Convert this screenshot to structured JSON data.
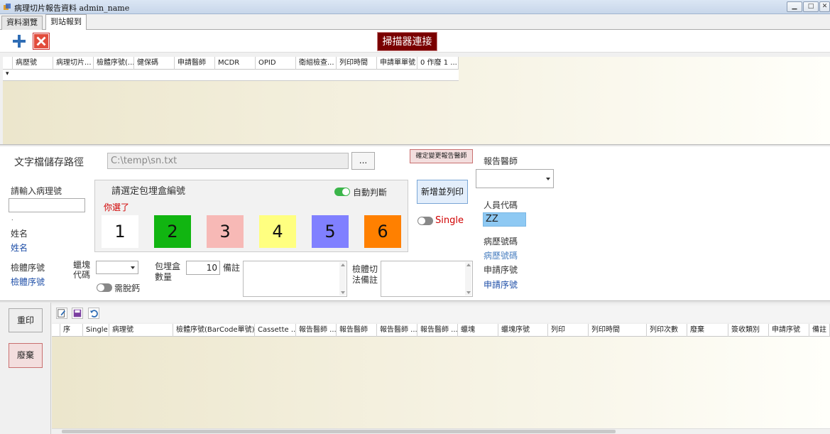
{
  "window": {
    "title": "病理切片報告資料 admin_name",
    "minimize_glyph": "▁",
    "maximize_glyph": "□",
    "close_glyph": "✕"
  },
  "tabs": [
    {
      "label": "資料瀏覽"
    },
    {
      "label": "到站報到"
    }
  ],
  "toolbar": {
    "add_icon": "plus-icon",
    "delete_icon": "close-icon",
    "scanner_label": "掃描器連接"
  },
  "top_grid": {
    "columns": [
      "病歷號",
      "病理切片...",
      "檢體序號(...",
      "健保碼",
      "申請醫師",
      "MCDR",
      "OPID",
      "衛組檢查...",
      "列印時間",
      "申請單單號",
      "0 作廢 1 ..."
    ],
    "row_marker": "▾"
  },
  "form": {
    "path_label": "文字檔儲存路徑",
    "path_value": "C:\\temp\\sn.txt",
    "browse_label": "...",
    "confirm_doctor_label": "確定變更報告醫師",
    "report_doctor_label": "報告醫師",
    "pathology_input_label": "請輸入病理號",
    "dot": ".",
    "name_label": "姓名",
    "name_value": "姓名",
    "specimen_no_label": "檢體序號",
    "specimen_no_value": "檢體序號",
    "block_code_label": "蠟塊代碼",
    "decal_label": "需脫鈣",
    "box_count_label": "包埋盒數量",
    "box_count_value": "10",
    "remark_label": "備註",
    "cutting_remark_label": "檢體切法備註",
    "new_print_label": "新增並列印",
    "single_label": "Single",
    "staff_code_label": "人員代碼",
    "staff_code_value": "ZZ",
    "chart_no_label": "病歷號碼",
    "chart_no_value": "病歷號碼",
    "application_no_label": "申請序號",
    "application_no_value": "申請序號"
  },
  "cassette": {
    "title": "請選定包埋盒編號",
    "auto_label": "自動判斷",
    "selected_text": "你選了",
    "boxes": [
      {
        "label": "1",
        "color": "#ffffff"
      },
      {
        "label": "2",
        "color": "#11b511"
      },
      {
        "label": "3",
        "color": "#f7b9b6"
      },
      {
        "label": "4",
        "color": "#ffff80"
      },
      {
        "label": "5",
        "color": "#8080ff"
      },
      {
        "label": "6",
        "color": "#ff8000"
      }
    ]
  },
  "bottom": {
    "reprint_label": "重印",
    "discard_label": "廢棄",
    "columns": [
      "序",
      "Single",
      "病理號",
      "檢體序號(BarCode單號)",
      "Cassette ...",
      "報告醫師 ...",
      "報告醫師",
      "報告醫師 ...",
      "報告醫師 ...",
      "蠟塊",
      "蠟塊序號",
      "列印",
      "列印時間",
      "列印次數",
      "廢棄",
      "簽收類別",
      "申請序號",
      "備註"
    ]
  },
  "colors": {
    "scanner_bg": "#7a0000",
    "accent_blue": "#1f4fa8",
    "selected_red": "#d00000",
    "toggle_on": "#3bb54a"
  }
}
